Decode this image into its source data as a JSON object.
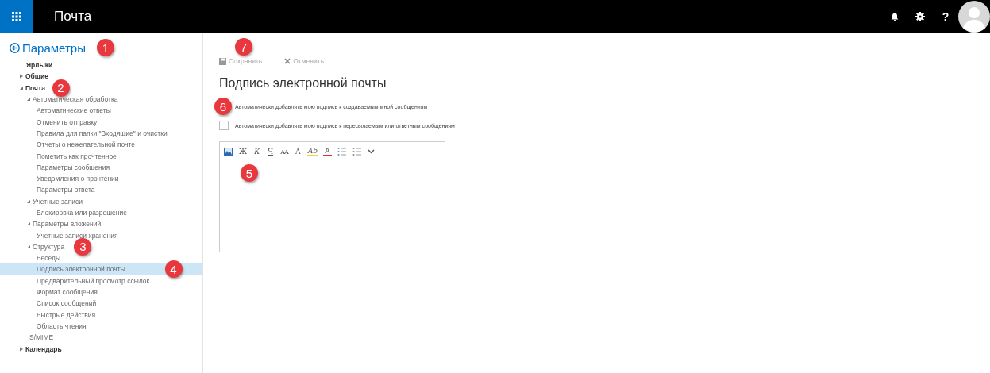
{
  "header": {
    "app_title": "Почта",
    "help": "?"
  },
  "back": {
    "label": "Параметры",
    "badge": "1"
  },
  "tree": [
    {
      "label": "Ярлыки",
      "selected": false
    },
    {
      "label": "Общие",
      "expanded": false,
      "selected": false
    },
    {
      "label": "Почта",
      "expanded": true,
      "selected": false,
      "badge": "2",
      "children": [
        {
          "label": "Автоматическая обработка",
          "expanded": true,
          "selected": false,
          "children": [
            {
              "label": "Автоматические ответы",
              "selected": false
            },
            {
              "label": "Отменить отправку",
              "selected": false
            },
            {
              "label": "Правила для папки \"Входящие\" и очистки",
              "selected": false
            },
            {
              "label": "Отчеты о нежелательной почте",
              "selected": false
            },
            {
              "label": "Пометить как прочтенное",
              "selected": false
            },
            {
              "label": "Параметры сообщения",
              "selected": false
            },
            {
              "label": "Уведомления о прочтении",
              "selected": false
            },
            {
              "label": "Параметры ответа",
              "selected": false
            }
          ]
        },
        {
          "label": "Учетные записи",
          "expanded": true,
          "selected": false,
          "children": [
            {
              "label": "Блокировка или разрешение",
              "selected": false
            }
          ]
        },
        {
          "label": "Параметры вложений",
          "expanded": true,
          "selected": false,
          "children": [
            {
              "label": "Учетные записи хранения",
              "selected": false
            }
          ]
        },
        {
          "label": "Структура",
          "expanded": true,
          "selected": false,
          "badge": "3",
          "children": [
            {
              "label": "Беседы",
              "selected": false
            },
            {
              "label": "Подпись электронной почты",
              "selected": true,
              "badge": "4"
            },
            {
              "label": "Предварительный просмотр ссылок",
              "selected": false
            },
            {
              "label": "Формат сообщения",
              "selected": false
            },
            {
              "label": "Список сообщений",
              "selected": false
            },
            {
              "label": "Быстрые действия",
              "selected": false
            },
            {
              "label": "Область чтения",
              "selected": false
            }
          ]
        },
        {
          "label": "S/MIME",
          "selected": false
        }
      ]
    },
    {
      "label": "Календарь",
      "expanded": false,
      "selected": false
    }
  ],
  "toolbar": {
    "save": "Сохранить",
    "cancel": "Отменить",
    "badge": "7",
    "disabled": true
  },
  "title": "Подпись электронной почты",
  "options": [
    {
      "label": "Автоматически добавлять мою подпись к создаваемым мной сообщениям",
      "badge": "6"
    },
    {
      "label": "Автоматически добавлять мою подпись к пересылаемым или ответным сообщениям",
      "checked": false
    }
  ],
  "editor": {
    "badge": "5",
    "tools": [
      {
        "kind": "image"
      },
      {
        "kind": "bold",
        "label": "Ж"
      },
      {
        "kind": "italic",
        "label": "К"
      },
      {
        "kind": "underline",
        "label": "Ч"
      },
      {
        "kind": "size",
        "label": "AA"
      },
      {
        "kind": "grow",
        "label": "A"
      },
      {
        "kind": "highlight",
        "label": "Ab"
      },
      {
        "kind": "color",
        "label": "A"
      },
      {
        "kind": "bullets"
      },
      {
        "kind": "numbering"
      },
      {
        "kind": "more"
      }
    ]
  }
}
